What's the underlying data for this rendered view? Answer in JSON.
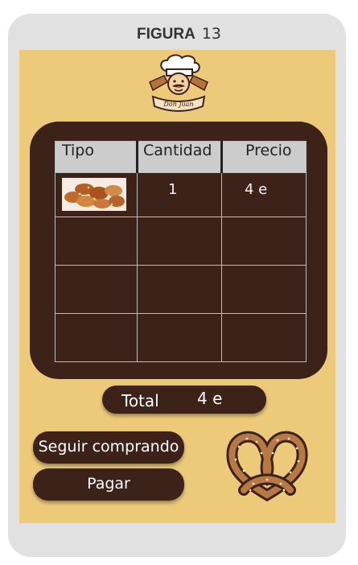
{
  "figure": {
    "label": "FIGURA",
    "number": "13"
  },
  "brand": {
    "logo_text": "Don Juan"
  },
  "cart": {
    "headers": [
      "Tipo",
      "Cantidad",
      "Precio"
    ],
    "rows": [
      {
        "item_image": "baked-pastries-photo",
        "quantity": "1",
        "price": "4 e"
      },
      {
        "quantity": "",
        "price": ""
      },
      {
        "quantity": "",
        "price": ""
      },
      {
        "quantity": "",
        "price": ""
      }
    ]
  },
  "total": {
    "label": "Total",
    "value": "4 e"
  },
  "buttons": {
    "keep_shopping": "Seguir comprando",
    "pay": "Pagar"
  },
  "colors": {
    "panel": "#3c2219",
    "background": "#ecca7a",
    "frame": "#e1e1e1",
    "header": "#cccccc"
  },
  "icons": {
    "decoration": "pretzel-icon",
    "logo": "chef-baker-logo"
  }
}
